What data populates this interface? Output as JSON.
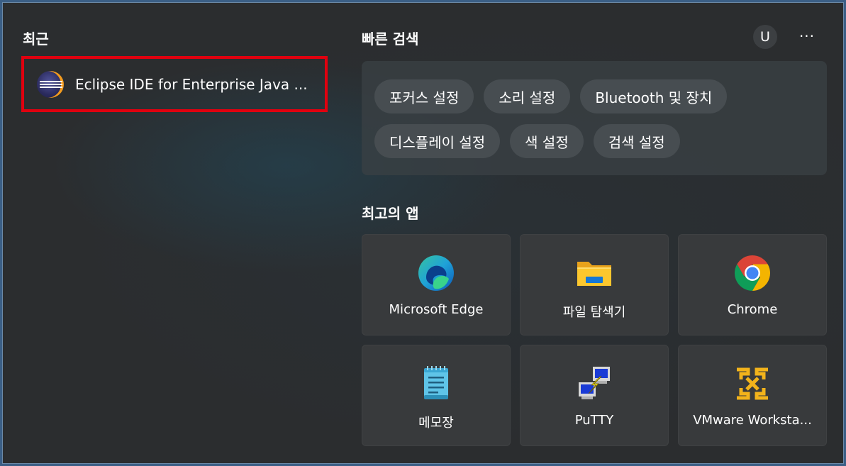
{
  "recent": {
    "title": "최근",
    "items": [
      {
        "label": "Eclipse IDE for Enterprise Java ...",
        "icon": "eclipse-icon"
      }
    ]
  },
  "quick_search": {
    "title": "빠른 검색",
    "chips_row1": [
      "포커스 설정",
      "소리 설정",
      "Bluetooth 및 장치"
    ],
    "chips_row2": [
      "디스플레이 설정",
      "색 설정",
      "검색 설정"
    ]
  },
  "user": {
    "avatar_initial": "U",
    "more_glyph": "···"
  },
  "top_apps": {
    "title": "최고의 앱",
    "apps": [
      {
        "label": "Microsoft Edge",
        "icon": "edge-icon"
      },
      {
        "label": "파일 탐색기",
        "icon": "file-explorer-icon"
      },
      {
        "label": "Chrome",
        "icon": "chrome-icon"
      },
      {
        "label": "메모장",
        "icon": "notepad-icon"
      },
      {
        "label": "PuTTY",
        "icon": "putty-icon"
      },
      {
        "label": "VMware Worksta...",
        "icon": "vmware-icon"
      }
    ]
  },
  "colors": {
    "highlight_border": "#e0000f",
    "panel_bg": "#2b2d2f",
    "chip_bg": "#474d51",
    "tile_bg": "#383a3c"
  }
}
